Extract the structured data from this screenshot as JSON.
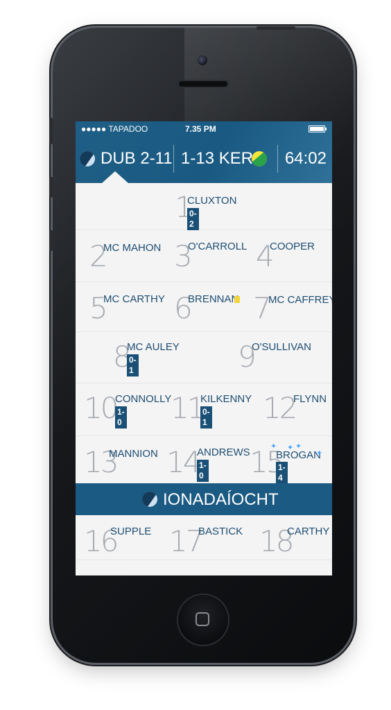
{
  "status": {
    "carrier": "●●●●● TAPADOO",
    "time": "7.35 PM"
  },
  "score": {
    "home": "DUB 2-11",
    "away": "1-13 KER",
    "clock": "64:02"
  },
  "players": {
    "p1": {
      "num": "1",
      "name": "CLUXTON",
      "score": "0-2"
    },
    "p2": {
      "num": "2",
      "name": "MC MAHON"
    },
    "p3": {
      "num": "3",
      "name": "O'CARROLL"
    },
    "p4": {
      "num": "4",
      "name": "COOPER"
    },
    "p5": {
      "num": "5",
      "name": "MC CARTHY"
    },
    "p6": {
      "num": "6",
      "name": "BRENNAN"
    },
    "p7": {
      "num": "7",
      "name": "MC CAFFREY"
    },
    "p8": {
      "num": "8",
      "name": "MC AULEY",
      "score": "0-1"
    },
    "p9": {
      "num": "9",
      "name": "O'SULLIVAN"
    },
    "p10": {
      "num": "10",
      "name": "CONNOLLY",
      "score": "1-0"
    },
    "p11": {
      "num": "11",
      "name": "KILKENNY",
      "score": "0-1"
    },
    "p12": {
      "num": "12",
      "name": "FLYNN"
    },
    "p13": {
      "num": "13",
      "name": "MANNION"
    },
    "p14": {
      "num": "14",
      "name": "ANDREWS",
      "score": "1-0"
    },
    "p15": {
      "num": "15",
      "name": "BROGAN",
      "score": "1-4"
    },
    "p16": {
      "num": "16",
      "name": "SUPPLE"
    },
    "p17": {
      "num": "17",
      "name": "BASTICK"
    },
    "p18": {
      "num": "18",
      "name": "CARTHY"
    }
  },
  "subs": {
    "label": "IONADAÍOCHT"
  },
  "colors": {
    "accent": "#1b5a82",
    "card_yellow": "#f2d53c",
    "background": "#f4f4f5"
  },
  "icons": {
    "home_crest": "dublin-crest-icon",
    "away_crest": "kerry-crest-icon",
    "battery": "battery-icon",
    "card": "yellow-card-icon",
    "stars": "star-sparkle-icon"
  }
}
